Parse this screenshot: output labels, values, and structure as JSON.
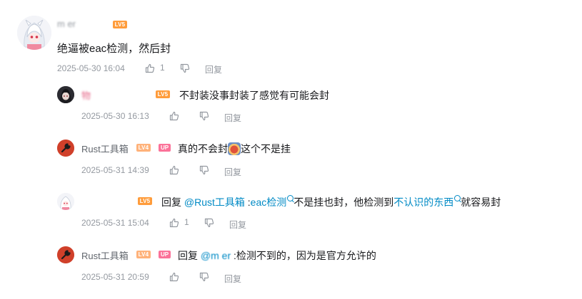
{
  "main_comment": {
    "username": "m          er",
    "level": "LV5",
    "content": "绝逼被eac检测，然后封",
    "time": "2025-05-30 16:04",
    "like_count": "1",
    "reply_label": "回复"
  },
  "replies": [
    {
      "username": "              物",
      "level": "LV5",
      "is_up": false,
      "content": "不封装没事封装了感觉有可能会封",
      "time": "2025-05-30 16:13",
      "like_count": "",
      "reply_label": "回复"
    },
    {
      "username": "Rust工具箱",
      "level": "LV4",
      "is_up": true,
      "up_label": "UP",
      "content_before": "真的不会封",
      "content_after": "这个不是挂",
      "time": "2025-05-31 14:39",
      "like_count": "",
      "reply_label": "回复"
    },
    {
      "username": "             ",
      "level": "LV5",
      "is_up": false,
      "reply_prefix": "回复",
      "mention": "@Rust工具箱",
      "mid": " :",
      "keyword1": "eac检测",
      "text1": "不是挂也封，他检测到",
      "keyword2": "不认识的东西",
      "text2": "就容易封",
      "time": "2025-05-31 15:04",
      "like_count": "1",
      "reply_label": "回复"
    },
    {
      "username": "Rust工具箱",
      "level": "LV4",
      "is_up": true,
      "up_label": "UP",
      "reply_prefix": "回复",
      "mention": "@m            er",
      "text": " :检测不到的，因为是官方允许的",
      "time": "2025-05-31 20:59",
      "like_count": "",
      "reply_label": "回复"
    }
  ],
  "icons": {
    "like": "thumbs-up-icon",
    "dislike": "thumbs-down-icon",
    "rust_avatar": "wrench-icon"
  },
  "colors": {
    "link": "#008ac5",
    "meta": "#9499a0",
    "level5": "#ff9c3b",
    "level4": "#ffb27a",
    "up_badge": "#fb7299",
    "rust_avatar_bg": "#d0402a"
  }
}
